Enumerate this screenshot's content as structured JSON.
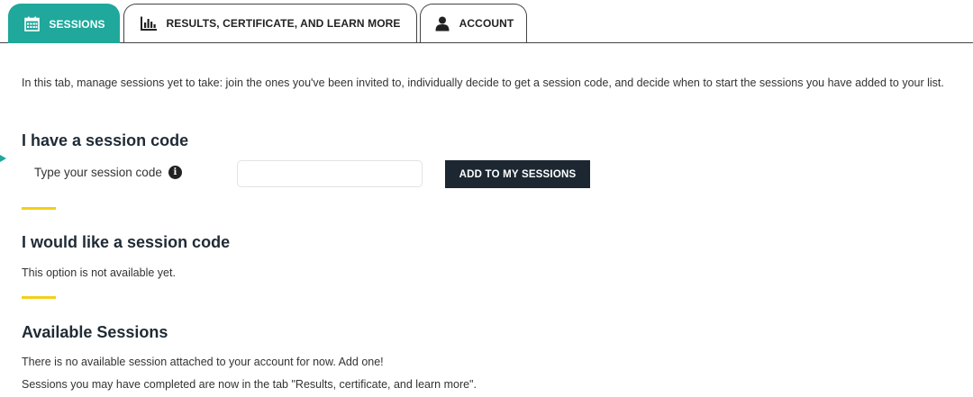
{
  "tabs": [
    {
      "label": "SESSIONS",
      "icon": "calendar-icon",
      "active": true
    },
    {
      "label": "RESULTS, CERTIFICATE, AND LEARN MORE",
      "icon": "bar-chart-icon",
      "active": false
    },
    {
      "label": "ACCOUNT",
      "icon": "user-icon",
      "active": false
    }
  ],
  "intro": "In this tab, manage sessions yet to take: join the ones you've been invited to, individually decide to get a session code, and decide when to start the sessions you have added to your list.",
  "have_code": {
    "title": "I have a session code",
    "label": "Type your session code",
    "info_icon": "i",
    "input_value": "",
    "button_label": "ADD TO MY SESSIONS"
  },
  "like_code": {
    "title": "I would like a session code",
    "text": "This option is not available yet."
  },
  "available": {
    "title": "Available Sessions",
    "empty_text": "There is no available session attached to your account for now. Add one!",
    "completed_text": "Sessions you may have completed are now in the tab \"Results, certificate, and learn more\"."
  },
  "colors": {
    "accent": "#1fa89b",
    "divider": "#f2cf18",
    "button_bg": "#1c2732",
    "heading": "#1f2b36"
  }
}
